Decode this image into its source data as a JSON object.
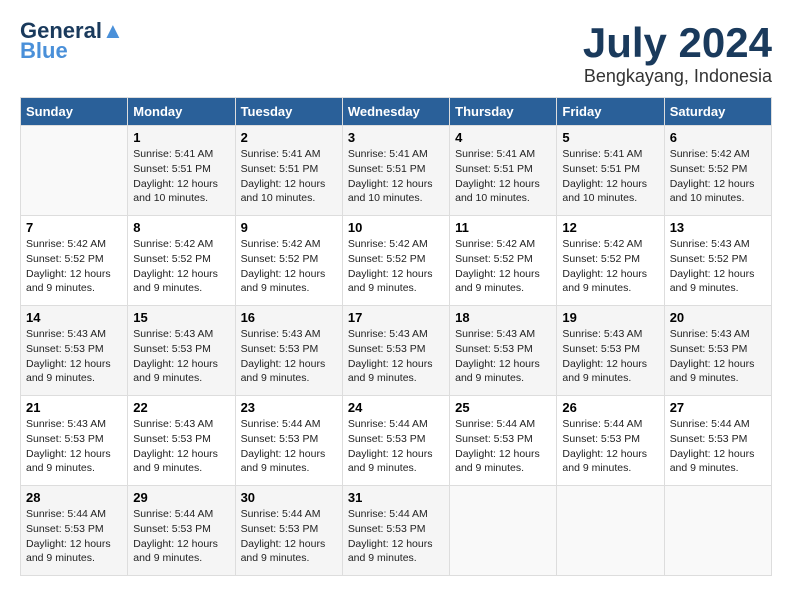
{
  "logo": {
    "line1": "General",
    "line2": "Blue"
  },
  "title": "July 2024",
  "location": "Bengkayang, Indonesia",
  "days_of_week": [
    "Sunday",
    "Monday",
    "Tuesday",
    "Wednesday",
    "Thursday",
    "Friday",
    "Saturday"
  ],
  "weeks": [
    [
      {
        "day": "",
        "info": ""
      },
      {
        "day": "1",
        "info": "Sunrise: 5:41 AM\nSunset: 5:51 PM\nDaylight: 12 hours\nand 10 minutes."
      },
      {
        "day": "2",
        "info": "Sunrise: 5:41 AM\nSunset: 5:51 PM\nDaylight: 12 hours\nand 10 minutes."
      },
      {
        "day": "3",
        "info": "Sunrise: 5:41 AM\nSunset: 5:51 PM\nDaylight: 12 hours\nand 10 minutes."
      },
      {
        "day": "4",
        "info": "Sunrise: 5:41 AM\nSunset: 5:51 PM\nDaylight: 12 hours\nand 10 minutes."
      },
      {
        "day": "5",
        "info": "Sunrise: 5:41 AM\nSunset: 5:51 PM\nDaylight: 12 hours\nand 10 minutes."
      },
      {
        "day": "6",
        "info": "Sunrise: 5:42 AM\nSunset: 5:52 PM\nDaylight: 12 hours\nand 10 minutes."
      }
    ],
    [
      {
        "day": "7",
        "info": "Sunrise: 5:42 AM\nSunset: 5:52 PM\nDaylight: 12 hours\nand 9 minutes."
      },
      {
        "day": "8",
        "info": "Sunrise: 5:42 AM\nSunset: 5:52 PM\nDaylight: 12 hours\nand 9 minutes."
      },
      {
        "day": "9",
        "info": "Sunrise: 5:42 AM\nSunset: 5:52 PM\nDaylight: 12 hours\nand 9 minutes."
      },
      {
        "day": "10",
        "info": "Sunrise: 5:42 AM\nSunset: 5:52 PM\nDaylight: 12 hours\nand 9 minutes."
      },
      {
        "day": "11",
        "info": "Sunrise: 5:42 AM\nSunset: 5:52 PM\nDaylight: 12 hours\nand 9 minutes."
      },
      {
        "day": "12",
        "info": "Sunrise: 5:42 AM\nSunset: 5:52 PM\nDaylight: 12 hours\nand 9 minutes."
      },
      {
        "day": "13",
        "info": "Sunrise: 5:43 AM\nSunset: 5:52 PM\nDaylight: 12 hours\nand 9 minutes."
      }
    ],
    [
      {
        "day": "14",
        "info": "Sunrise: 5:43 AM\nSunset: 5:53 PM\nDaylight: 12 hours\nand 9 minutes."
      },
      {
        "day": "15",
        "info": "Sunrise: 5:43 AM\nSunset: 5:53 PM\nDaylight: 12 hours\nand 9 minutes."
      },
      {
        "day": "16",
        "info": "Sunrise: 5:43 AM\nSunset: 5:53 PM\nDaylight: 12 hours\nand 9 minutes."
      },
      {
        "day": "17",
        "info": "Sunrise: 5:43 AM\nSunset: 5:53 PM\nDaylight: 12 hours\nand 9 minutes."
      },
      {
        "day": "18",
        "info": "Sunrise: 5:43 AM\nSunset: 5:53 PM\nDaylight: 12 hours\nand 9 minutes."
      },
      {
        "day": "19",
        "info": "Sunrise: 5:43 AM\nSunset: 5:53 PM\nDaylight: 12 hours\nand 9 minutes."
      },
      {
        "day": "20",
        "info": "Sunrise: 5:43 AM\nSunset: 5:53 PM\nDaylight: 12 hours\nand 9 minutes."
      }
    ],
    [
      {
        "day": "21",
        "info": "Sunrise: 5:43 AM\nSunset: 5:53 PM\nDaylight: 12 hours\nand 9 minutes."
      },
      {
        "day": "22",
        "info": "Sunrise: 5:43 AM\nSunset: 5:53 PM\nDaylight: 12 hours\nand 9 minutes."
      },
      {
        "day": "23",
        "info": "Sunrise: 5:44 AM\nSunset: 5:53 PM\nDaylight: 12 hours\nand 9 minutes."
      },
      {
        "day": "24",
        "info": "Sunrise: 5:44 AM\nSunset: 5:53 PM\nDaylight: 12 hours\nand 9 minutes."
      },
      {
        "day": "25",
        "info": "Sunrise: 5:44 AM\nSunset: 5:53 PM\nDaylight: 12 hours\nand 9 minutes."
      },
      {
        "day": "26",
        "info": "Sunrise: 5:44 AM\nSunset: 5:53 PM\nDaylight: 12 hours\nand 9 minutes."
      },
      {
        "day": "27",
        "info": "Sunrise: 5:44 AM\nSunset: 5:53 PM\nDaylight: 12 hours\nand 9 minutes."
      }
    ],
    [
      {
        "day": "28",
        "info": "Sunrise: 5:44 AM\nSunset: 5:53 PM\nDaylight: 12 hours\nand 9 minutes."
      },
      {
        "day": "29",
        "info": "Sunrise: 5:44 AM\nSunset: 5:53 PM\nDaylight: 12 hours\nand 9 minutes."
      },
      {
        "day": "30",
        "info": "Sunrise: 5:44 AM\nSunset: 5:53 PM\nDaylight: 12 hours\nand 9 minutes."
      },
      {
        "day": "31",
        "info": "Sunrise: 5:44 AM\nSunset: 5:53 PM\nDaylight: 12 hours\nand 9 minutes."
      },
      {
        "day": "",
        "info": ""
      },
      {
        "day": "",
        "info": ""
      },
      {
        "day": "",
        "info": ""
      }
    ]
  ]
}
